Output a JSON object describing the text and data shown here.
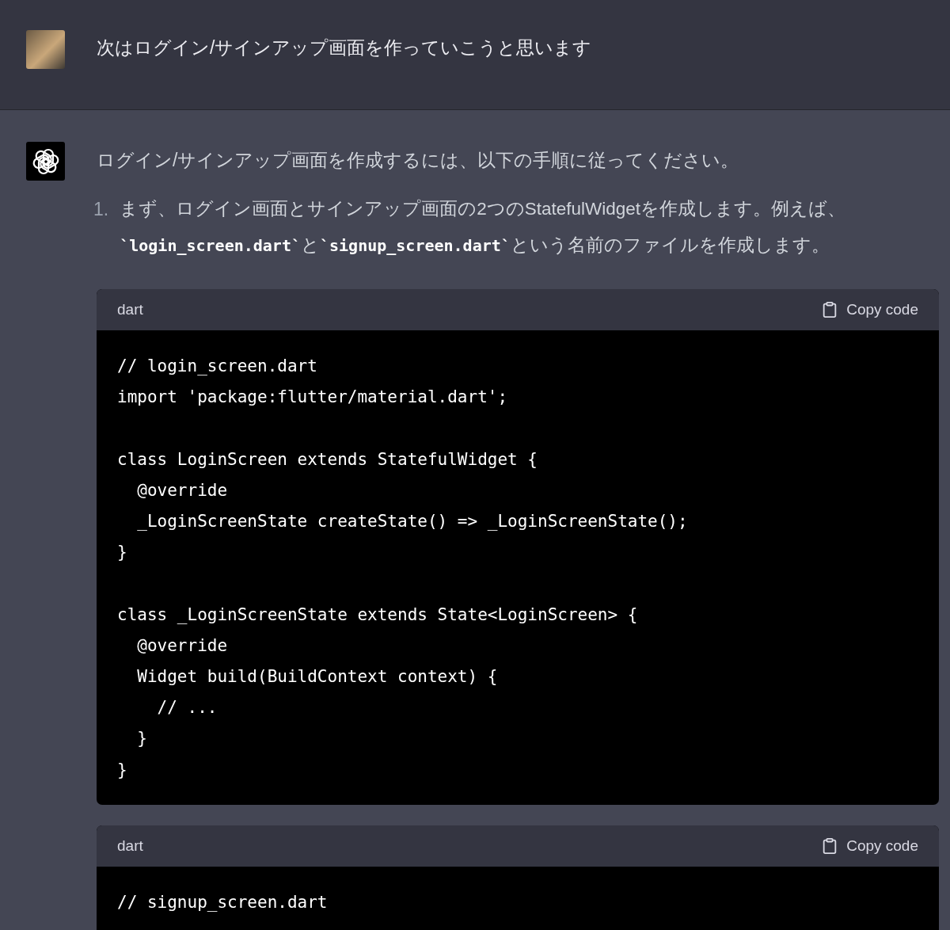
{
  "user_message": {
    "text": "次はログイン/サインアップ画面を作っていこうと思います"
  },
  "assistant_message": {
    "intro": "ログイン/サインアップ画面を作成するには、以下の手順に従ってください。",
    "steps": [
      {
        "number": "1.",
        "segments": [
          {
            "kind": "text",
            "text": "まず、ログイン画面とサインアップ画面の2つのStatefulWidgetを作成します。例えば、"
          },
          {
            "kind": "code",
            "text": "`login_screen.dart`"
          },
          {
            "kind": "text",
            "text": "と"
          },
          {
            "kind": "code",
            "text": "`signup_screen.dart`"
          },
          {
            "kind": "text",
            "text": "という名前のファイルを作成します。"
          }
        ]
      }
    ],
    "code_blocks": [
      {
        "language": "dart",
        "copy_label": "Copy code",
        "code": "// login_screen.dart\nimport 'package:flutter/material.dart';\n\nclass LoginScreen extends StatefulWidget {\n  @override\n  _LoginScreenState createState() => _LoginScreenState();\n}\n\nclass _LoginScreenState extends State<LoginScreen> {\n  @override\n  Widget build(BuildContext context) {\n    // ...\n  }\n}"
      },
      {
        "language": "dart",
        "copy_label": "Copy code",
        "code": "// signup_screen.dart"
      }
    ]
  }
}
